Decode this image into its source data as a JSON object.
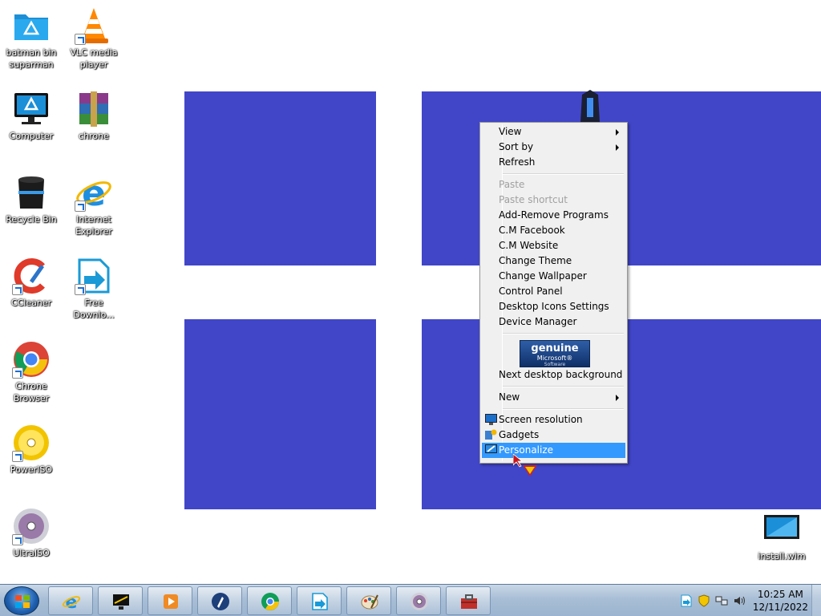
{
  "desktop": {
    "icons": [
      {
        "label": "batman bin suparman"
      },
      {
        "label": "VLC media player"
      },
      {
        "label": "Computer"
      },
      {
        "label": "chrone"
      },
      {
        "label": "Recycle Bin"
      },
      {
        "label": "Internet Explorer"
      },
      {
        "label": "CCleaner"
      },
      {
        "label": "Free Downlo..."
      },
      {
        "label": "Chrone Browser"
      },
      {
        "label": "PowerISO"
      },
      {
        "label": "UltraISO"
      },
      {
        "label": "install.wim"
      }
    ]
  },
  "context_menu": {
    "items": [
      {
        "label": "View"
      },
      {
        "label": "Sort by"
      },
      {
        "label": "Refresh"
      },
      {
        "label": "Paste"
      },
      {
        "label": "Paste shortcut"
      },
      {
        "label": "Add-Remove Programs"
      },
      {
        "label": "C.M Facebook"
      },
      {
        "label": "C.M Website"
      },
      {
        "label": "Change Theme"
      },
      {
        "label": "Change Wallpaper"
      },
      {
        "label": "Control Panel"
      },
      {
        "label": "Desktop Icons Settings"
      },
      {
        "label": "Device Manager"
      },
      {
        "label": "Next desktop background"
      },
      {
        "label": "New"
      },
      {
        "label": "Screen resolution"
      },
      {
        "label": "Gadgets"
      },
      {
        "label": "Personalize"
      }
    ],
    "genuine": {
      "line1": "genuine",
      "line2": "Microsoft®",
      "line3": "Software"
    }
  },
  "taskbar": {
    "apps": [
      "internet-explorer-icon",
      "cm-app-icon",
      "media-player-icon",
      "rocket-icon",
      "chrome-icon",
      "free-download-manager-icon",
      "paint-icon",
      "dvd-icon",
      "toolbox-icon"
    ],
    "clock": {
      "time": "10:25 AM",
      "date": "12/11/2022"
    }
  },
  "colors": {
    "wallpaper_blue": "#4146c9",
    "highlight": "#3399ff"
  }
}
